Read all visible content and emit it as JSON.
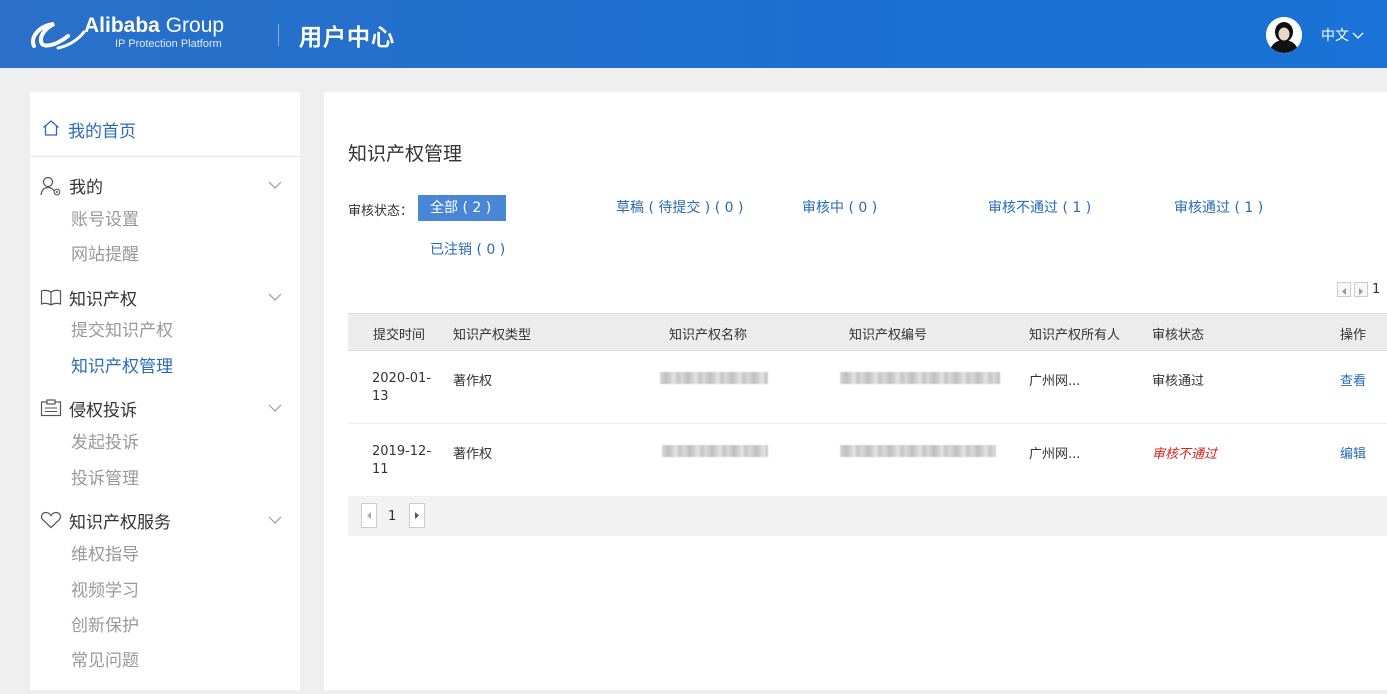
{
  "header": {
    "logo_brand": "Alibaba",
    "logo_group": "Group",
    "logo_sub": "IP Protection Platform",
    "title": "用户中心",
    "language": "中文",
    "bg_color": "#1c6fd0"
  },
  "sidebar": {
    "home_label": "我的首页",
    "groups": [
      {
        "label": "我的",
        "icon": "user-icon",
        "items": [
          "账号设置",
          "网站提醒"
        ]
      },
      {
        "label": "知识产权",
        "icon": "book-icon",
        "items": [
          "提交知识产权",
          "知识产权管理"
        ]
      },
      {
        "label": "侵权投诉",
        "icon": "clipboard-icon",
        "items": [
          "发起投诉",
          "投诉管理"
        ]
      },
      {
        "label": "知识产权服务",
        "icon": "heart-icon",
        "items": [
          "维权指导",
          "视频学习",
          "创新保护",
          "常见问题"
        ]
      }
    ],
    "active_item": "知识产权管理"
  },
  "main": {
    "title": "知识产权管理",
    "filter_label": "审核状态：",
    "filters": [
      "全部 ( 2 )",
      "草稿 ( 待提交 ) ( 0 )",
      "审核中 ( 0 )",
      "审核不通过 ( 1 )",
      "审核通过 ( 1 )",
      "已注销 ( 0 )"
    ],
    "active_filter": "全部 ( 2 )",
    "top_page": "1",
    "table": {
      "columns": [
        "提交时间",
        "知识产权类型",
        "知识产权名称",
        "知识产权编号",
        "知识产权所有人",
        "审核状态",
        "操作"
      ],
      "rows": [
        {
          "date": "2020-01-13",
          "type": "著作权",
          "owner": "广州网...",
          "status": "审核通过",
          "action": "查看"
        },
        {
          "date": "2019-12-11",
          "type": "著作权",
          "owner": "广州网...",
          "status": "审核不通过",
          "action": "编辑"
        }
      ]
    },
    "bottom_page": "1"
  }
}
